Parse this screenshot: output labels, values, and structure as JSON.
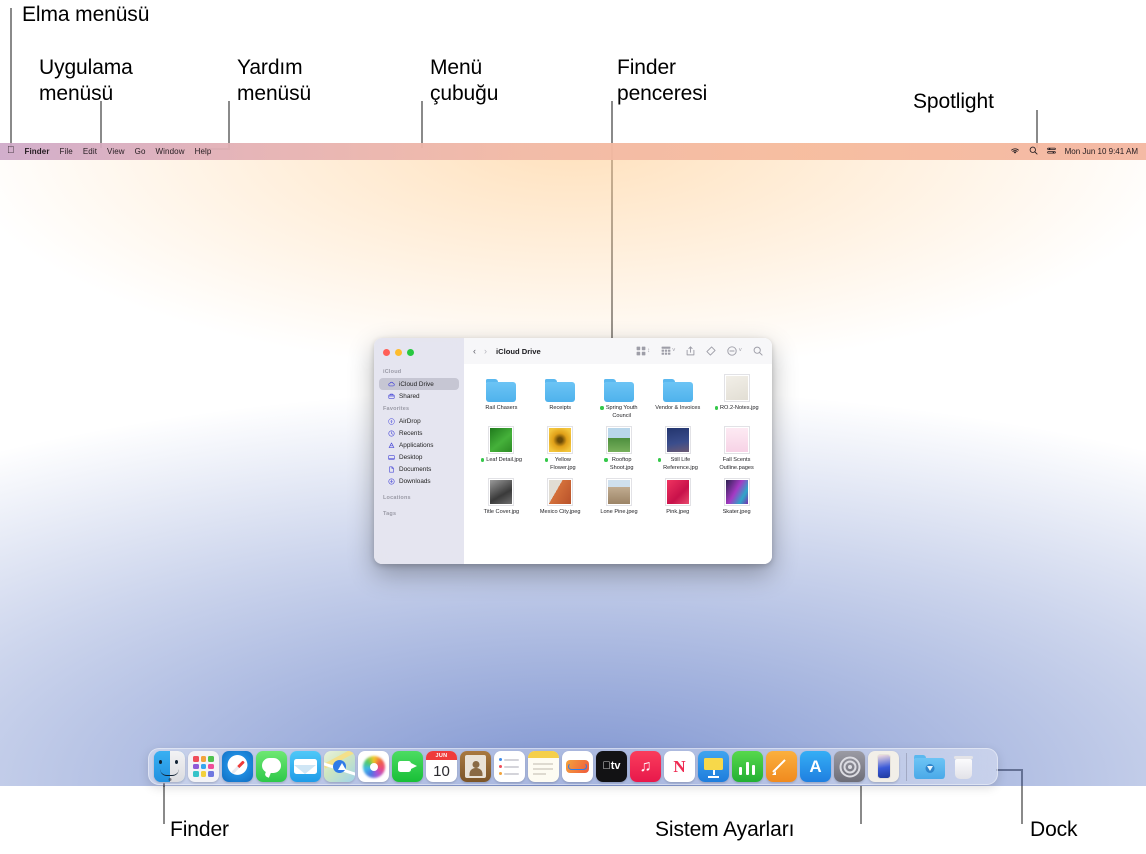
{
  "annotations": [
    {
      "id": "apple-menu",
      "label": "Elma menüsü"
    },
    {
      "id": "app-menu",
      "label": "Uygulama\nmenüsü"
    },
    {
      "id": "help-menu",
      "label": "Yardım\nmenüsü"
    },
    {
      "id": "menu-bar",
      "label": "Menü\nçubuğu"
    },
    {
      "id": "finder-window",
      "label": "Finder\npenceresi"
    },
    {
      "id": "spotlight",
      "label": "Spotlight"
    },
    {
      "id": "finder",
      "label": "Finder"
    },
    {
      "id": "system-settings",
      "label": "Sistem Ayarları"
    },
    {
      "id": "dock",
      "label": "Dock"
    }
  ],
  "menubar": {
    "apple_glyph": "",
    "items": [
      {
        "label": "Finder",
        "bold": true
      },
      {
        "label": "File",
        "bold": false
      },
      {
        "label": "Edit",
        "bold": false
      },
      {
        "label": "View",
        "bold": false
      },
      {
        "label": "Go",
        "bold": false
      },
      {
        "label": "Window",
        "bold": false
      },
      {
        "label": "Help",
        "bold": false
      }
    ],
    "status": {
      "wifi_icon": "wifi-icon",
      "spotlight_icon": "search-icon",
      "control_center_icon": "control-center-icon",
      "clock": "Mon Jun 10 9:41 AM"
    }
  },
  "finder_window": {
    "title": "iCloud Drive",
    "traffic_lights": {
      "close": "close-button",
      "minimize": "minimize-button",
      "zoom": "zoom-button"
    },
    "toolbar": {
      "back_icon": "chevron-left-icon",
      "forward_icon": "chevron-right-icon",
      "view_icon": "icon-view-icon",
      "group_icon": "group-by-icon",
      "share_icon": "share-icon",
      "tag_icon": "tag-icon",
      "more_icon": "more-actions-icon",
      "search_icon": "search-icon"
    },
    "sidebar": [
      {
        "type": "header",
        "label": "iCloud"
      },
      {
        "type": "item",
        "label": "iCloud Drive",
        "icon": "cloud-icon",
        "selected": true
      },
      {
        "type": "item",
        "label": "Shared",
        "icon": "shared-folder-icon",
        "selected": false
      },
      {
        "type": "header",
        "label": "Favorites"
      },
      {
        "type": "item",
        "label": "AirDrop",
        "icon": "airdrop-icon",
        "selected": false
      },
      {
        "type": "item",
        "label": "Recents",
        "icon": "clock-icon",
        "selected": false
      },
      {
        "type": "item",
        "label": "Applications",
        "icon": "applications-icon",
        "selected": false
      },
      {
        "type": "item",
        "label": "Desktop",
        "icon": "desktop-icon",
        "selected": false
      },
      {
        "type": "item",
        "label": "Documents",
        "icon": "document-icon",
        "selected": false
      },
      {
        "type": "item",
        "label": "Downloads",
        "icon": "downloads-icon",
        "selected": false
      },
      {
        "type": "header",
        "label": "Locations"
      },
      {
        "type": "header",
        "label": "Tags"
      }
    ],
    "files": [
      {
        "name": "Rail Chasers",
        "kind": "folder",
        "badge": false
      },
      {
        "name": "Receipts",
        "kind": "folder",
        "badge": false
      },
      {
        "name": "Spring Youth\nCouncil",
        "kind": "folder",
        "badge": true
      },
      {
        "name": "Vendor & Invoices",
        "kind": "folder",
        "badge": false
      },
      {
        "name": "RO.2-Notes.jpg",
        "kind": "image",
        "badge": true,
        "color": "#e9e6e0"
      },
      {
        "name": "Leaf Detail.jpg",
        "kind": "image",
        "badge": true,
        "color": "#2f8a2b"
      },
      {
        "name": "Yellow\nFlower.jpg",
        "kind": "image",
        "badge": true,
        "color": "#e8a81a"
      },
      {
        "name": "Rooftop\nShoot.jpg",
        "kind": "image",
        "badge": true,
        "color": "#9fc3dd"
      },
      {
        "name": "Still Life\nReference.jpg",
        "kind": "image",
        "badge": true,
        "color": "#2b3f7a"
      },
      {
        "name": "Fall Scents\nOutline.pages",
        "kind": "image",
        "badge": false,
        "color": "#f6d9ea"
      },
      {
        "name": "Title Cover.jpg",
        "kind": "image",
        "badge": false,
        "color": "#555555"
      },
      {
        "name": "Mexico City.jpeg",
        "kind": "image",
        "badge": false,
        "color": "#d4773f"
      },
      {
        "name": "Lone Pine.jpeg",
        "kind": "image",
        "badge": false,
        "color": "#b6a18a"
      },
      {
        "name": "Pink.jpeg",
        "kind": "image",
        "badge": false,
        "color": "#e8264f"
      },
      {
        "name": "Skater.jpeg",
        "kind": "image",
        "badge": false,
        "color": "#9b3ac4"
      }
    ]
  },
  "dock": {
    "apps": [
      {
        "name": "Finder",
        "icon": "finder-icon",
        "running": true
      },
      {
        "name": "Launchpad",
        "icon": "launchpad-icon",
        "running": false
      },
      {
        "name": "Safari",
        "icon": "safari-icon",
        "running": false
      },
      {
        "name": "Messages",
        "icon": "messages-icon",
        "running": false
      },
      {
        "name": "Mail",
        "icon": "mail-icon",
        "running": false
      },
      {
        "name": "Maps",
        "icon": "maps-icon",
        "running": false
      },
      {
        "name": "Photos",
        "icon": "photos-icon",
        "running": false
      },
      {
        "name": "FaceTime",
        "icon": "facetime-icon",
        "running": false
      },
      {
        "name": "Calendar",
        "icon": "calendar-icon",
        "running": false,
        "month": "JUN",
        "day": "10"
      },
      {
        "name": "Contacts",
        "icon": "contacts-icon",
        "running": false
      },
      {
        "name": "Reminders",
        "icon": "reminders-icon",
        "running": false
      },
      {
        "name": "Notes",
        "icon": "notes-icon",
        "running": false
      },
      {
        "name": "Freeform",
        "icon": "freeform-icon",
        "running": false
      },
      {
        "name": "Apple TV",
        "icon": "appletv-icon",
        "running": false
      },
      {
        "name": "Music",
        "icon": "music-icon",
        "running": false
      },
      {
        "name": "News",
        "icon": "news-icon",
        "running": false
      },
      {
        "name": "Keynote",
        "icon": "keynote-icon",
        "running": false
      },
      {
        "name": "Numbers",
        "icon": "numbers-icon",
        "running": false
      },
      {
        "name": "Pages",
        "icon": "pages-icon",
        "running": false
      },
      {
        "name": "App Store",
        "icon": "appstore-icon",
        "running": false
      },
      {
        "name": "System Settings",
        "icon": "system-settings-icon",
        "running": false
      },
      {
        "name": "iPhone Mirroring",
        "icon": "iphone-mirroring-icon",
        "running": false
      }
    ],
    "extras": [
      {
        "name": "Downloads",
        "icon": "downloads-folder-icon"
      },
      {
        "name": "Trash",
        "icon": "trash-icon"
      }
    ]
  },
  "colors": {
    "leader": "#8a8a8a",
    "accent_blue": "#4fb2ec",
    "badge_green": "#35c84a",
    "traffic_red": "#ff5f57",
    "traffic_yellow": "#febc2e",
    "traffic_green": "#28c840"
  }
}
